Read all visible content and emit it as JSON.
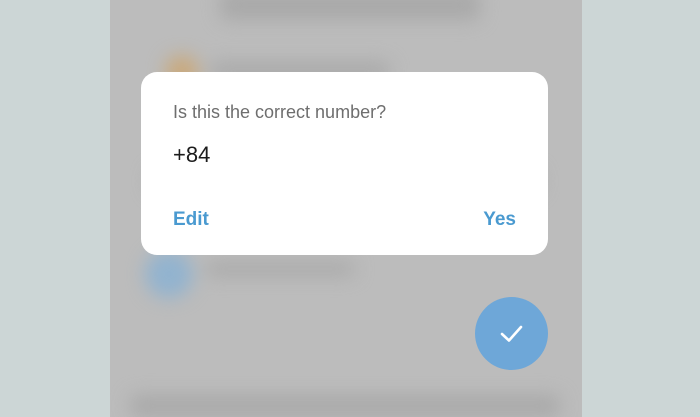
{
  "dialog": {
    "title": "Is this the correct number?",
    "phone_number": "+84",
    "edit_label": "Edit",
    "yes_label": "Yes"
  },
  "fab": {
    "icon": "check-icon"
  },
  "colors": {
    "accent": "#4a9ad0",
    "fab": "#6ea7d8",
    "outer_background": "#ccd6d6",
    "dimmed_screen": "#bcbcbc"
  }
}
